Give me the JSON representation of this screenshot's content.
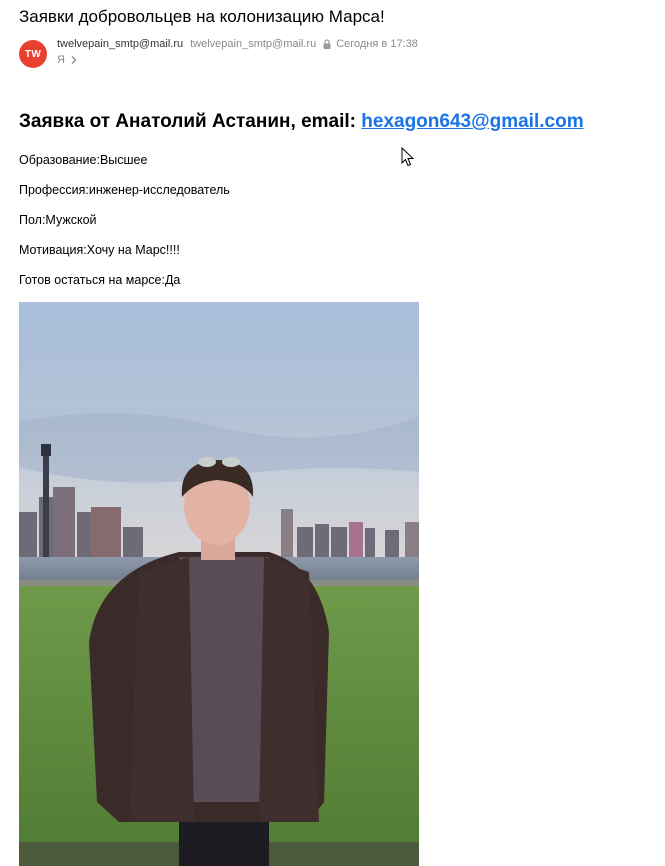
{
  "email": {
    "subject": "Заявки добровольцев на колонизацию Марса!",
    "avatar_initials": "TW",
    "avatar_color": "#e8412f",
    "sender_name": "twelvepain_smtp@mail.ru",
    "sender_email": "twelvepain_smtp@mail.ru",
    "date": "Сегодня в 17:38",
    "recipient": "Я",
    "heading_prefix": "Заявка от Анатолий Астанин, email: ",
    "heading_email": "hexagon643@gmail.com",
    "link_color": "#1a73e8",
    "fields": [
      "Образование:Высшее",
      "Профессия:инженер-исследователь",
      "Пол:Мужской",
      "Мотивация:Хочу на Марс!!!!",
      "Готов остаться на марсе:Да"
    ]
  },
  "icons": {
    "lock": "lock-icon",
    "chevron": "chevron-right-icon",
    "cursor": "mouse-cursor-icon"
  }
}
